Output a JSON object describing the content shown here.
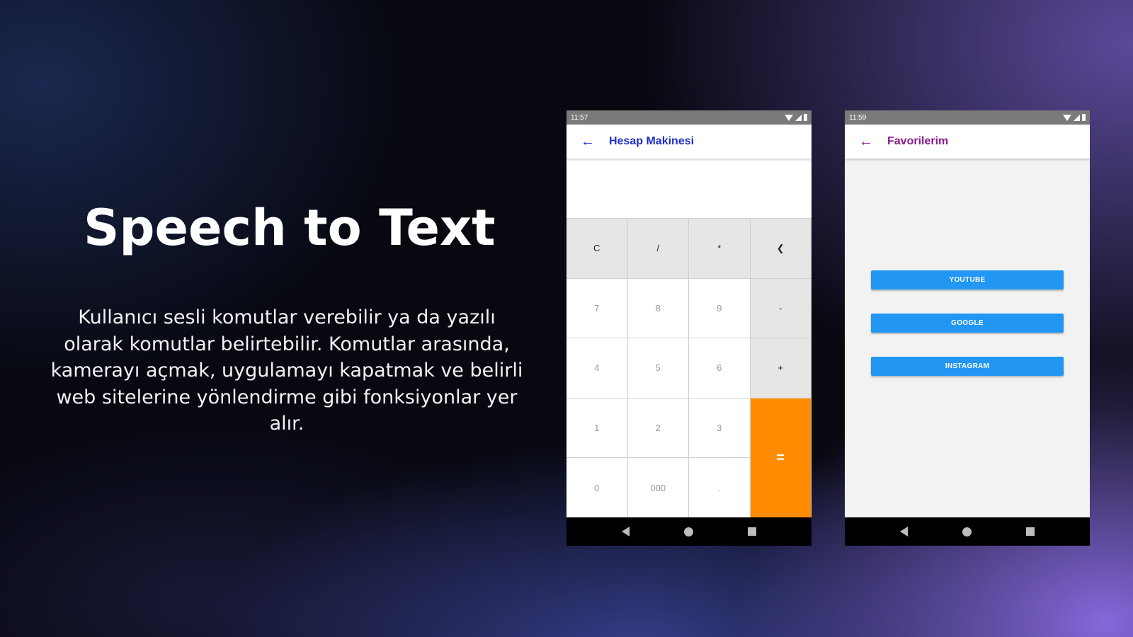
{
  "slide": {
    "title": "Speech to Text",
    "description": "Kullanıcı sesli komutlar verebilir ya da yazılı olarak komutlar belirtebilir. Komutlar arasında, kamerayı açmak, uygulamayı kapatmak ve belirli web sitelerine yönlendirme gibi fonksiyonlar yer alır."
  },
  "calculator": {
    "status_time": "11:57",
    "back_icon": "arrow-left-icon",
    "title": "Hesap Makinesi",
    "display_value": "",
    "keys": [
      "C",
      "/",
      "*",
      "❮",
      "7",
      "8",
      "9",
      "-",
      "4",
      "5",
      "6",
      "+",
      "1",
      "2",
      "3",
      "=",
      "0",
      "000",
      "."
    ],
    "accent_color": "#ff8c00",
    "title_color": "#1f2fc8"
  },
  "favorites": {
    "status_time": "11:59",
    "back_icon": "arrow-left-icon",
    "title": "Favorilerim",
    "buttons": [
      "YOUTUBE",
      "GOOGLE",
      "INSTAGRAM"
    ],
    "button_color": "#2196f3",
    "title_color": "#8a1b8e"
  }
}
